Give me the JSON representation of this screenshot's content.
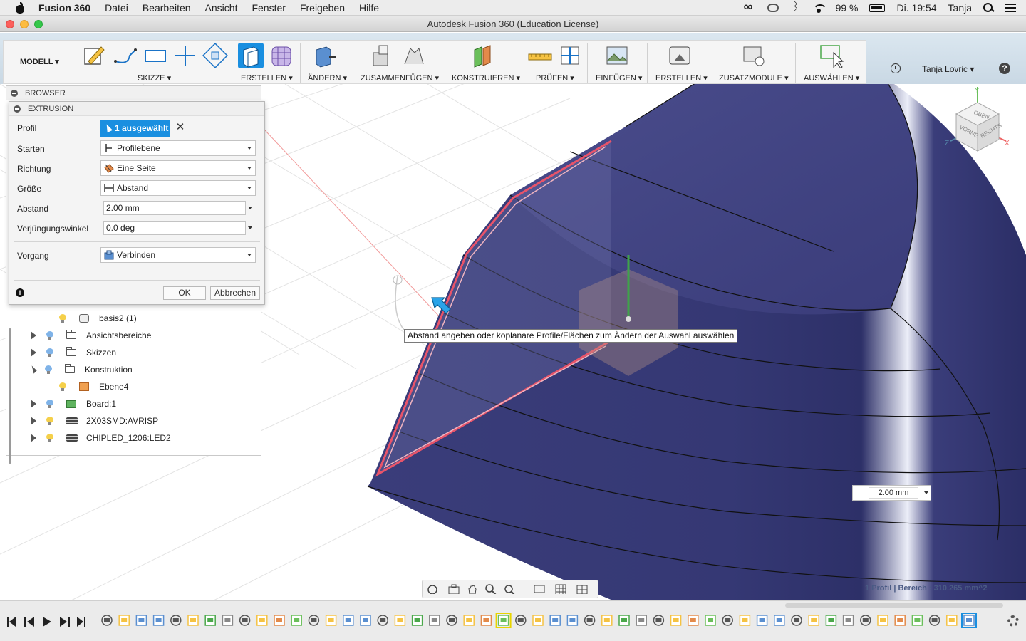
{
  "menubar": {
    "app_name": "Fusion 360",
    "items": [
      "Datei",
      "Bearbeiten",
      "Ansicht",
      "Fenster",
      "Freigeben",
      "Hilfe"
    ],
    "battery": "99 %",
    "clock": "Di. 19:54",
    "user": "Tanja"
  },
  "window": {
    "title": "Autodesk Fusion 360 (Education License)"
  },
  "toolbar": {
    "workspace": "MODELL",
    "groups": {
      "skizze": "SKIZZE",
      "erstellen": "ERSTELLEN",
      "aendern": "ÄNDERN",
      "zusammenfuegen": "ZUSAMMENFÜGEN",
      "konstruieren": "KONSTRUIEREN",
      "pruefen": "PRÜFEN",
      "einfuegen": "EINFÜGEN",
      "erstellen2": "ERSTELLEN",
      "zusatzmodule": "ZUSATZMODULE",
      "auswaehlen": "AUSWÄHLEN"
    },
    "user": "Tanja Lovric"
  },
  "browser": {
    "title": "BROWSER",
    "items": [
      {
        "label": "basis2 (1)"
      },
      {
        "label": "Ansichtsbereiche"
      },
      {
        "label": "Skizzen"
      },
      {
        "label": "Konstruktion"
      },
      {
        "label": "Ebene4"
      },
      {
        "label": "Board:1"
      },
      {
        "label": "2X03SMD:AVRISP"
      },
      {
        "label": "CHIPLED_1206:LED2"
      }
    ]
  },
  "extrusion": {
    "title": "EXTRUSION",
    "profil_label": "Profil",
    "profil_value": "1 ausgewählt",
    "starten_label": "Starten",
    "starten_value": "Profilebene",
    "richtung_label": "Richtung",
    "richtung_value": "Eine Seite",
    "groesse_label": "Größe",
    "groesse_value": "Abstand",
    "abstand_label": "Abstand",
    "abstand_value": "2.00 mm",
    "winkel_label": "Verjüngungswinkel",
    "winkel_value": "0.0 deg",
    "vorgang_label": "Vorgang",
    "vorgang_value": "Verbinden",
    "ok": "OK",
    "cancel": "Abbrechen"
  },
  "canvas": {
    "tooltip": "Abstand angeben oder koplanare Profile/Flächen zum Ändern der Auswahl auswählen",
    "distance_value": "2.00 mm",
    "status": "1 Profil | Bereich : 310.265 mm^2",
    "viewcube": {
      "top": "OBEN",
      "front": "VORNE",
      "right": "RECHTS",
      "x": "X",
      "y": "Y",
      "z": "Z"
    }
  },
  "colors": {
    "accent": "#1a8fe0",
    "body": "#3b3d78",
    "highlight": "#e8546a"
  }
}
